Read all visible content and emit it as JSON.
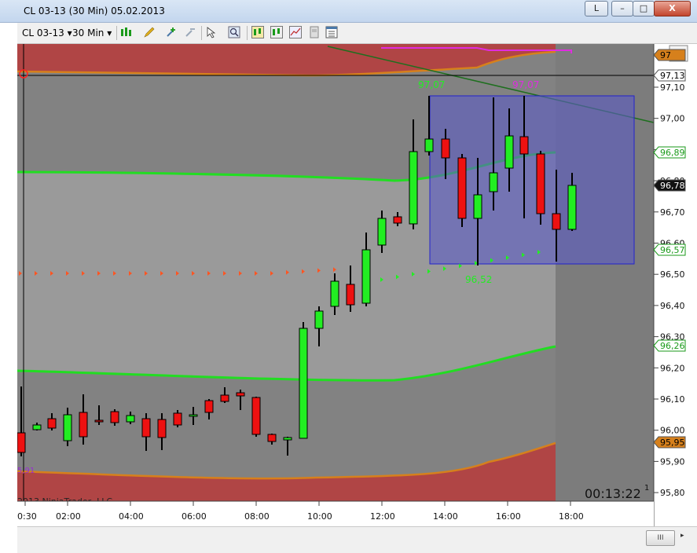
{
  "window": {
    "title": "CL 03-13 (30 Min)  05.02.2013",
    "help_label": "L",
    "min_label": "–",
    "max_label": "□",
    "close_label": "X"
  },
  "toolbar": {
    "instrument": "CL 03-13",
    "interval": "30 Min"
  },
  "chart": {
    "price_labels": [
      "97,10",
      "97,00",
      "96,90",
      "96,80",
      "96,70",
      "96,60",
      "96,50",
      "96,40",
      "96,30",
      "96,20",
      "96,10",
      "96,00",
      "95,90",
      "95,80"
    ],
    "badges": {
      "top": "97",
      "crosshair": "97,13",
      "b1": "96,89",
      "last": "96,78",
      "b2": "96,57",
      "b3": "96,26",
      "b4": "95,95"
    },
    "time_labels": [
      "0:30",
      "02:00",
      "04:00",
      "06:00",
      "08:00",
      "10:00",
      "12:00",
      "14:00",
      "16:00",
      "18:00"
    ],
    "annotations": {
      "high_green": "97,07",
      "high_magenta": "97,07",
      "low_green": "96,52",
      "left_purple": "5,91"
    },
    "copyright": "2013 NinjaTrader, LLC",
    "timer": "00:13:22",
    "page_marker": "1"
  },
  "colors": {
    "bg_dark": "#7c7c7c",
    "band_light": "#9a9a9a",
    "red_fill": "#b04545",
    "green_line": "#22dd22",
    "orange": "#d6801c",
    "magenta": "#e02ce0",
    "box_fill": "#5c5cc4",
    "box_border": "#2222cc",
    "bull": "#22ee22",
    "bear": "#ee1111"
  },
  "scrollbar": {
    "thumb_label": "III",
    "arrow_label": "▸"
  }
}
